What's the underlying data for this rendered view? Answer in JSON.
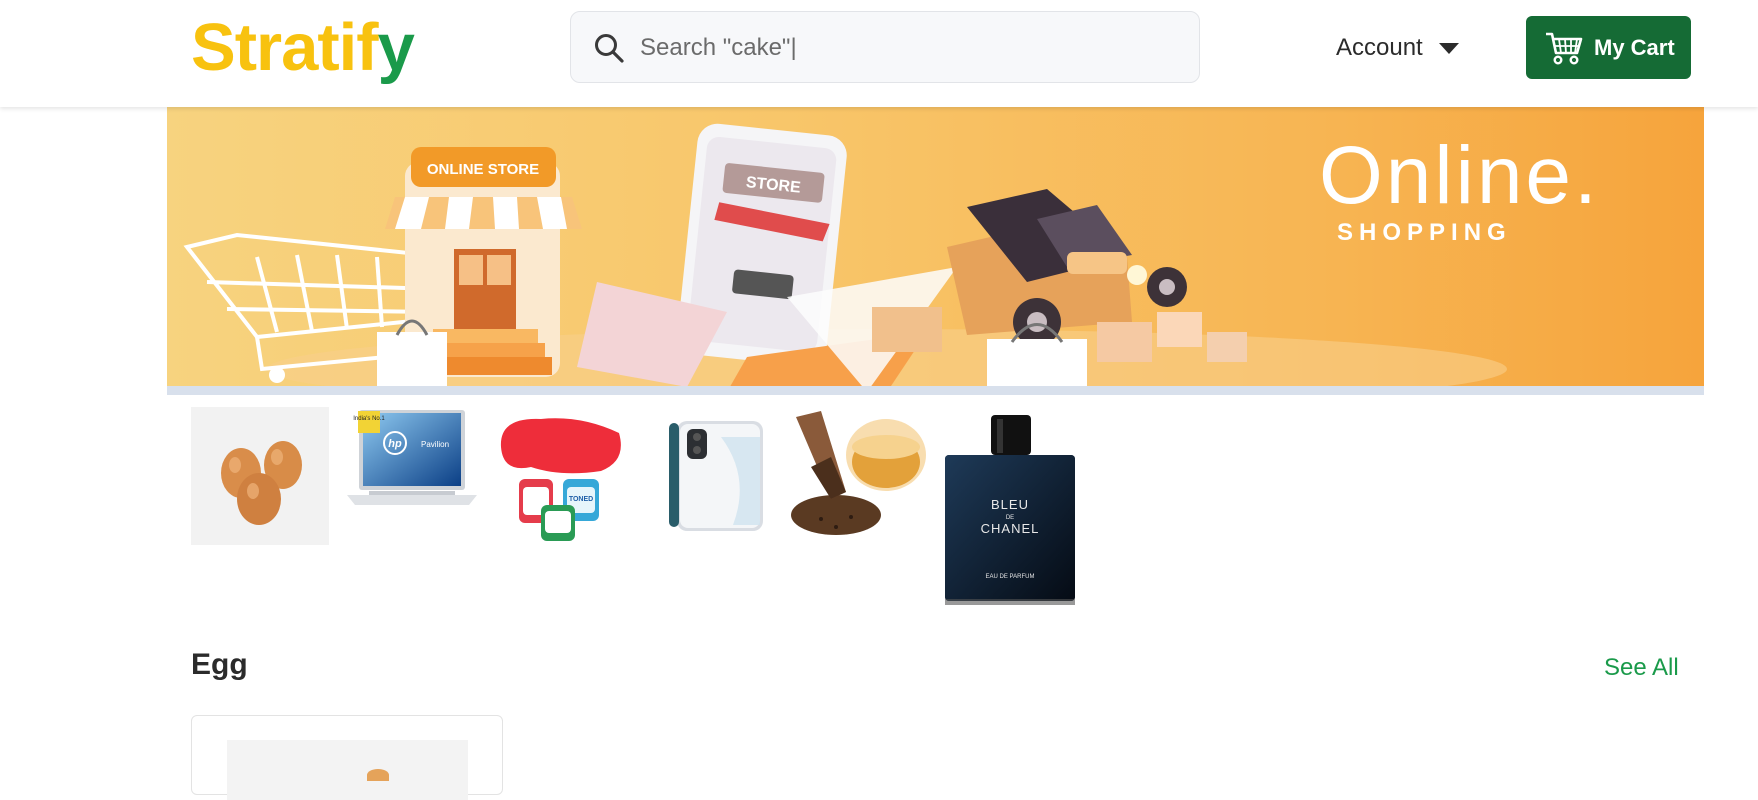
{
  "header": {
    "logo_part1": "Stratif",
    "logo_part2": "y",
    "search_value": "Search \"cake\"|",
    "account_label": "Account",
    "cart_label": "My Cart"
  },
  "banner": {
    "headline": "Online.",
    "subline": "SHOPPING",
    "store_sign": "ONLINE STORE",
    "phone_sign": "STORE"
  },
  "categories": [
    {
      "name": "eggs-thumbnail"
    },
    {
      "name": "laptop-thumbnail",
      "badge": "India's No.1",
      "brand": "hp",
      "model": "Pavilion"
    },
    {
      "name": "milk-thumbnail",
      "text": "TONED"
    },
    {
      "name": "phone-thumbnail"
    },
    {
      "name": "mustard-oil-thumbnail"
    },
    {
      "name": "perfume-thumbnail",
      "line1": "BLEU",
      "line2": "DE",
      "line3": "CHANEL",
      "line4": "EAU DE PARFUM"
    }
  ],
  "section": {
    "title": "Egg",
    "see_all": "See All"
  },
  "colors": {
    "logo_yellow": "#f8c20f",
    "logo_green": "#1a9a4a",
    "cart_bg": "#156b35",
    "see_all": "#1a9a4a"
  }
}
